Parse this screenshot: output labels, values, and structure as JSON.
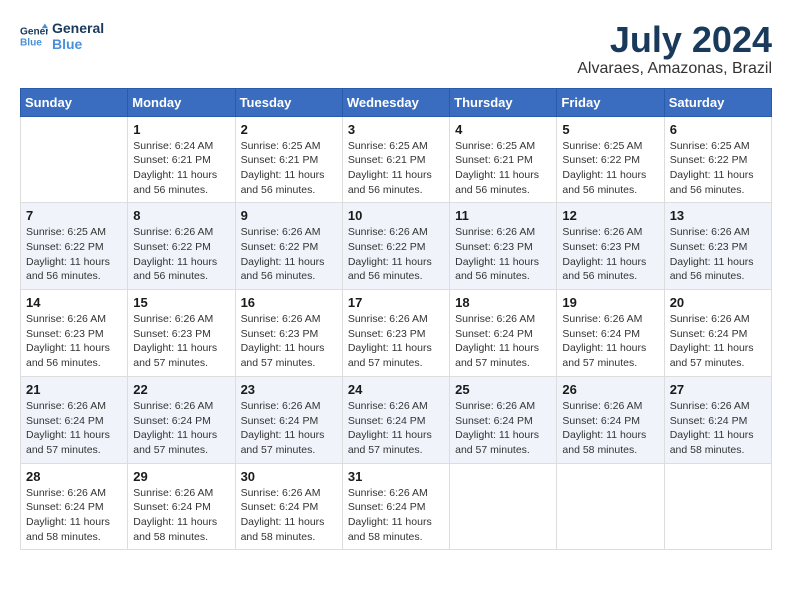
{
  "logo": {
    "line1": "General",
    "line2": "Blue"
  },
  "title": "July 2024",
  "location": "Alvaraes, Amazonas, Brazil",
  "days_of_week": [
    "Sunday",
    "Monday",
    "Tuesday",
    "Wednesday",
    "Thursday",
    "Friday",
    "Saturday"
  ],
  "weeks": [
    [
      {
        "day": "",
        "sunrise": "",
        "sunset": "",
        "daylight": ""
      },
      {
        "day": "1",
        "sunrise": "Sunrise: 6:24 AM",
        "sunset": "Sunset: 6:21 PM",
        "daylight": "Daylight: 11 hours and 56 minutes."
      },
      {
        "day": "2",
        "sunrise": "Sunrise: 6:25 AM",
        "sunset": "Sunset: 6:21 PM",
        "daylight": "Daylight: 11 hours and 56 minutes."
      },
      {
        "day": "3",
        "sunrise": "Sunrise: 6:25 AM",
        "sunset": "Sunset: 6:21 PM",
        "daylight": "Daylight: 11 hours and 56 minutes."
      },
      {
        "day": "4",
        "sunrise": "Sunrise: 6:25 AM",
        "sunset": "Sunset: 6:21 PM",
        "daylight": "Daylight: 11 hours and 56 minutes."
      },
      {
        "day": "5",
        "sunrise": "Sunrise: 6:25 AM",
        "sunset": "Sunset: 6:22 PM",
        "daylight": "Daylight: 11 hours and 56 minutes."
      },
      {
        "day": "6",
        "sunrise": "Sunrise: 6:25 AM",
        "sunset": "Sunset: 6:22 PM",
        "daylight": "Daylight: 11 hours and 56 minutes."
      }
    ],
    [
      {
        "day": "7",
        "sunrise": "Sunrise: 6:25 AM",
        "sunset": "Sunset: 6:22 PM",
        "daylight": "Daylight: 11 hours and 56 minutes."
      },
      {
        "day": "8",
        "sunrise": "Sunrise: 6:26 AM",
        "sunset": "Sunset: 6:22 PM",
        "daylight": "Daylight: 11 hours and 56 minutes."
      },
      {
        "day": "9",
        "sunrise": "Sunrise: 6:26 AM",
        "sunset": "Sunset: 6:22 PM",
        "daylight": "Daylight: 11 hours and 56 minutes."
      },
      {
        "day": "10",
        "sunrise": "Sunrise: 6:26 AM",
        "sunset": "Sunset: 6:22 PM",
        "daylight": "Daylight: 11 hours and 56 minutes."
      },
      {
        "day": "11",
        "sunrise": "Sunrise: 6:26 AM",
        "sunset": "Sunset: 6:23 PM",
        "daylight": "Daylight: 11 hours and 56 minutes."
      },
      {
        "day": "12",
        "sunrise": "Sunrise: 6:26 AM",
        "sunset": "Sunset: 6:23 PM",
        "daylight": "Daylight: 11 hours and 56 minutes."
      },
      {
        "day": "13",
        "sunrise": "Sunrise: 6:26 AM",
        "sunset": "Sunset: 6:23 PM",
        "daylight": "Daylight: 11 hours and 56 minutes."
      }
    ],
    [
      {
        "day": "14",
        "sunrise": "Sunrise: 6:26 AM",
        "sunset": "Sunset: 6:23 PM",
        "daylight": "Daylight: 11 hours and 56 minutes."
      },
      {
        "day": "15",
        "sunrise": "Sunrise: 6:26 AM",
        "sunset": "Sunset: 6:23 PM",
        "daylight": "Daylight: 11 hours and 57 minutes."
      },
      {
        "day": "16",
        "sunrise": "Sunrise: 6:26 AM",
        "sunset": "Sunset: 6:23 PM",
        "daylight": "Daylight: 11 hours and 57 minutes."
      },
      {
        "day": "17",
        "sunrise": "Sunrise: 6:26 AM",
        "sunset": "Sunset: 6:23 PM",
        "daylight": "Daylight: 11 hours and 57 minutes."
      },
      {
        "day": "18",
        "sunrise": "Sunrise: 6:26 AM",
        "sunset": "Sunset: 6:24 PM",
        "daylight": "Daylight: 11 hours and 57 minutes."
      },
      {
        "day": "19",
        "sunrise": "Sunrise: 6:26 AM",
        "sunset": "Sunset: 6:24 PM",
        "daylight": "Daylight: 11 hours and 57 minutes."
      },
      {
        "day": "20",
        "sunrise": "Sunrise: 6:26 AM",
        "sunset": "Sunset: 6:24 PM",
        "daylight": "Daylight: 11 hours and 57 minutes."
      }
    ],
    [
      {
        "day": "21",
        "sunrise": "Sunrise: 6:26 AM",
        "sunset": "Sunset: 6:24 PM",
        "daylight": "Daylight: 11 hours and 57 minutes."
      },
      {
        "day": "22",
        "sunrise": "Sunrise: 6:26 AM",
        "sunset": "Sunset: 6:24 PM",
        "daylight": "Daylight: 11 hours and 57 minutes."
      },
      {
        "day": "23",
        "sunrise": "Sunrise: 6:26 AM",
        "sunset": "Sunset: 6:24 PM",
        "daylight": "Daylight: 11 hours and 57 minutes."
      },
      {
        "day": "24",
        "sunrise": "Sunrise: 6:26 AM",
        "sunset": "Sunset: 6:24 PM",
        "daylight": "Daylight: 11 hours and 57 minutes."
      },
      {
        "day": "25",
        "sunrise": "Sunrise: 6:26 AM",
        "sunset": "Sunset: 6:24 PM",
        "daylight": "Daylight: 11 hours and 57 minutes."
      },
      {
        "day": "26",
        "sunrise": "Sunrise: 6:26 AM",
        "sunset": "Sunset: 6:24 PM",
        "daylight": "Daylight: 11 hours and 58 minutes."
      },
      {
        "day": "27",
        "sunrise": "Sunrise: 6:26 AM",
        "sunset": "Sunset: 6:24 PM",
        "daylight": "Daylight: 11 hours and 58 minutes."
      }
    ],
    [
      {
        "day": "28",
        "sunrise": "Sunrise: 6:26 AM",
        "sunset": "Sunset: 6:24 PM",
        "daylight": "Daylight: 11 hours and 58 minutes."
      },
      {
        "day": "29",
        "sunrise": "Sunrise: 6:26 AM",
        "sunset": "Sunset: 6:24 PM",
        "daylight": "Daylight: 11 hours and 58 minutes."
      },
      {
        "day": "30",
        "sunrise": "Sunrise: 6:26 AM",
        "sunset": "Sunset: 6:24 PM",
        "daylight": "Daylight: 11 hours and 58 minutes."
      },
      {
        "day": "31",
        "sunrise": "Sunrise: 6:26 AM",
        "sunset": "Sunset: 6:24 PM",
        "daylight": "Daylight: 11 hours and 58 minutes."
      },
      {
        "day": "",
        "sunrise": "",
        "sunset": "",
        "daylight": ""
      },
      {
        "day": "",
        "sunrise": "",
        "sunset": "",
        "daylight": ""
      },
      {
        "day": "",
        "sunrise": "",
        "sunset": "",
        "daylight": ""
      }
    ]
  ]
}
